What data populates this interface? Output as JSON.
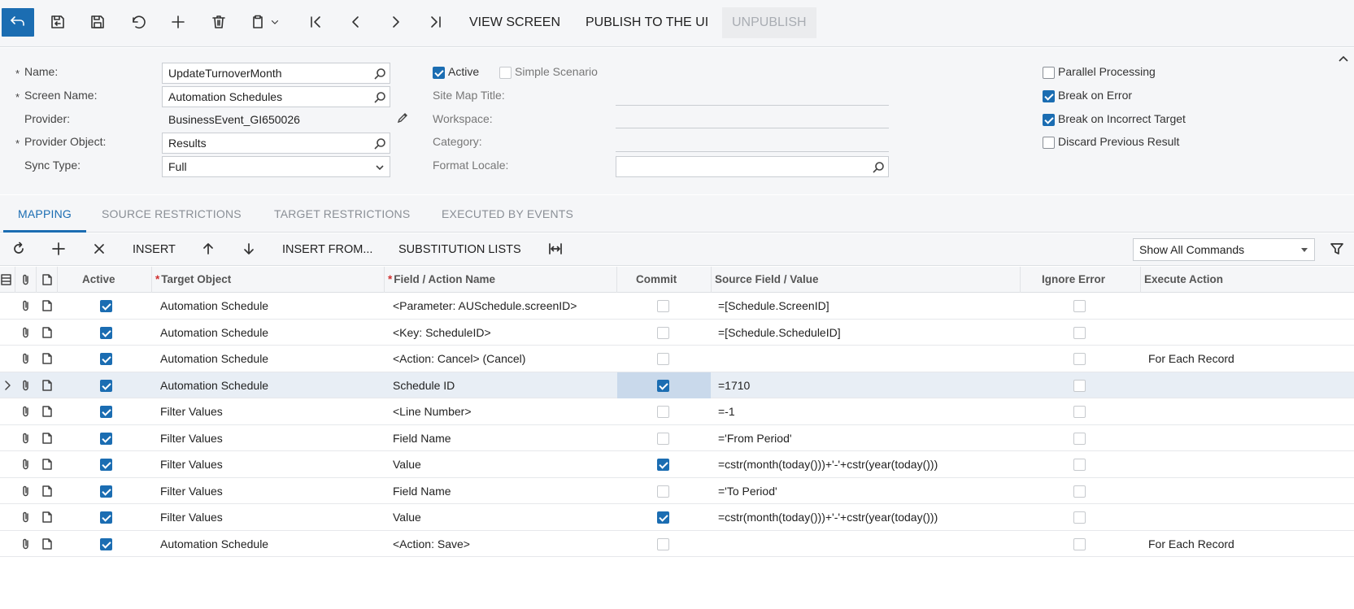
{
  "toolbar": {
    "view_screen": "VIEW SCREEN",
    "publish": "PUBLISH TO THE UI",
    "unpublish": "UNPUBLISH"
  },
  "form": {
    "name_label": "Name:",
    "name_value": "UpdateTurnoverMonth",
    "screen_name_label": "Screen Name:",
    "screen_name_value": "Automation Schedules",
    "provider_label": "Provider:",
    "provider_value": "BusinessEvent_GI650026",
    "provider_object_label": "Provider Object:",
    "provider_object_value": "Results",
    "sync_type_label": "Sync Type:",
    "sync_type_value": "Full",
    "active_label": "Active",
    "active_checked": true,
    "simple_scenario_label": "Simple Scenario",
    "site_map_title_label": "Site Map Title:",
    "workspace_label": "Workspace:",
    "category_label": "Category:",
    "format_locale_label": "Format Locale:",
    "parallel_label": "Parallel Processing",
    "break_error_label": "Break on Error",
    "break_target_label": "Break on Incorrect Target",
    "discard_label": "Discard Previous Result",
    "required_mark": "*"
  },
  "tabs": [
    "MAPPING",
    "SOURCE RESTRICTIONS",
    "TARGET RESTRICTIONS",
    "EXECUTED BY EVENTS"
  ],
  "grid_toolbar": {
    "insert": "INSERT",
    "insert_from": "INSERT FROM...",
    "substitution_lists": "SUBSTITUTION LISTS",
    "show_commands": "Show All Commands"
  },
  "grid": {
    "headers": {
      "active": "Active",
      "target_object": "Target Object",
      "field_action": "Field / Action Name",
      "commit": "Commit",
      "source": "Source Field / Value",
      "ignore_error": "Ignore Error",
      "execute_action": "Execute Action"
    },
    "rows": [
      {
        "active": true,
        "target": "Automation Schedule",
        "field": "<Parameter: AUSchedule.screenID>",
        "commit": false,
        "source": "=[Schedule.ScreenID]",
        "ignore": false,
        "execute": ""
      },
      {
        "active": true,
        "target": "Automation Schedule",
        "field": "<Key: ScheduleID>",
        "commit": false,
        "source": "=[Schedule.ScheduleID]",
        "ignore": false,
        "execute": ""
      },
      {
        "active": true,
        "target": "Automation Schedule",
        "field": "<Action: Cancel> (Cancel)",
        "commit": false,
        "source": "",
        "ignore": false,
        "execute": "For Each Record"
      },
      {
        "active": true,
        "target": "Automation Schedule",
        "field": "Schedule ID",
        "commit": true,
        "source": "=1710",
        "ignore": false,
        "execute": "",
        "selected": true
      },
      {
        "active": true,
        "target": "Filter Values",
        "field": "<Line Number>",
        "commit": false,
        "source": "=-1",
        "ignore": false,
        "execute": ""
      },
      {
        "active": true,
        "target": "Filter Values",
        "field": "Field Name",
        "commit": false,
        "source": "='From Period'",
        "ignore": false,
        "execute": ""
      },
      {
        "active": true,
        "target": "Filter Values",
        "field": "Value",
        "commit": true,
        "source": "=cstr(month(today()))+'-'+cstr(year(today()))",
        "ignore": false,
        "execute": ""
      },
      {
        "active": true,
        "target": "Filter Values",
        "field": "Field Name",
        "commit": false,
        "source": "='To Period'",
        "ignore": false,
        "execute": ""
      },
      {
        "active": true,
        "target": "Filter Values",
        "field": "Value",
        "commit": true,
        "source": "=cstr(month(today()))+'-'+cstr(year(today()))",
        "ignore": false,
        "execute": ""
      },
      {
        "active": true,
        "target": "Automation Schedule",
        "field": "<Action: Save>",
        "commit": false,
        "source": "",
        "ignore": false,
        "execute": "For Each Record"
      }
    ]
  },
  "colors": {
    "accent": "#1b6db2",
    "selected_row": "#e8eef5",
    "panel": "#f5f6f8"
  }
}
